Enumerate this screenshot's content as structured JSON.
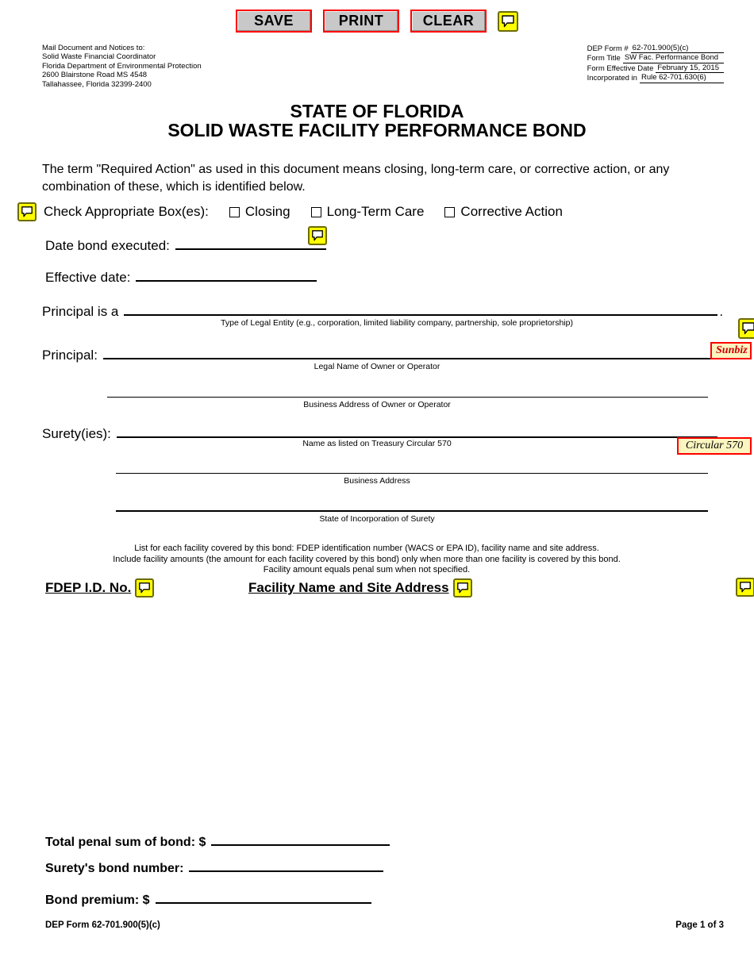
{
  "toolbar": {
    "save_label": "SAVE",
    "print_label": "PRINT",
    "clear_label": "CLEAR",
    "comment_icon": "comment-icon",
    "button_face_color": "#c8c8c8",
    "button_border_color": "#ff0000"
  },
  "header": {
    "mail_to_lines": [
      "Mail Document and Notices to:",
      "Solid Waste Financial Coordinator",
      "Florida Department of Environmental Protection",
      "2600 Blairstone Road MS 4548",
      "Tallahassee, Florida 32399-2400"
    ],
    "form_meta": [
      {
        "label": "DEP Form #",
        "value": "62-701.900(5)(c)"
      },
      {
        "label": "Form Title",
        "value": "SW Fac. Performance Bond"
      },
      {
        "label": "Form Effective Date",
        "value": "February 15, 2015"
      },
      {
        "label": "Incorporated in",
        "value": "Rule 62-701.630(6)"
      }
    ]
  },
  "title": {
    "line1": "STATE OF FLORIDA",
    "line2": "SOLID WASTE FACILITY PERFORMANCE BOND"
  },
  "intro": {
    "paragraph": "The term \"Required Action\" as used in this document means closing, long-term care, or corrective action, or any combination of these, which is identified below."
  },
  "checkboxes": {
    "label": "Check Appropriate Box(es):",
    "options": [
      {
        "label": "Closing",
        "checked": false
      },
      {
        "label": "Long-Term Care",
        "checked": false
      },
      {
        "label": "Corrective Action",
        "checked": false
      }
    ]
  },
  "fields": {
    "date_bond_executed_label": "Date bond executed:",
    "date_bond_executed_value": "",
    "effective_date_label": "Effective date:",
    "effective_date_value": "",
    "principal_is_a_label": "Principal is a",
    "principal_is_a_value": "",
    "principal_is_a_period": ".",
    "principal_is_a_caption": "Type of Legal Entity (e.g., corporation, limited liability company, partnership, sole proprietorship)",
    "principal_label": "Principal:",
    "principal_value": "",
    "principal_caption": "Legal Name of Owner or Operator",
    "principal_address_value": "",
    "principal_address_caption": "Business Address of Owner or Operator",
    "surety_label": "Surety(ies):",
    "surety_value": "",
    "surety_caption": "Name as listed on Treasury Circular 570",
    "surety_address_value": "",
    "surety_address_caption": "Business Address",
    "surety_state_value": "",
    "surety_state_caption": "State of Incorporation of Surety"
  },
  "lookups": {
    "sunbiz_label": "Sunbiz",
    "circular_label": "Circular 570"
  },
  "facility": {
    "note_lines": [
      "List for each facility covered by this bond:  FDEP identification number (WACS or EPA ID), facility name and site address.",
      "Include facility amounts (the amount for each facility covered by this bond) only when more than one facility is covered by this bond.",
      "Facility amount equals penal sum when not specified."
    ],
    "column_id_label": "FDEP I.D. No.",
    "column_name_label": "Facility Name and Site Address",
    "rows": []
  },
  "totals": [
    {
      "label": "Total penal sum of bond: $",
      "value": ""
    },
    {
      "label": "Surety's bond number:",
      "value": ""
    },
    {
      "label": "Bond premium: $",
      "value": ""
    }
  ],
  "footer": {
    "left": "DEP Form 62-701.900(5)(c)",
    "right": "Page 1 of 3"
  }
}
